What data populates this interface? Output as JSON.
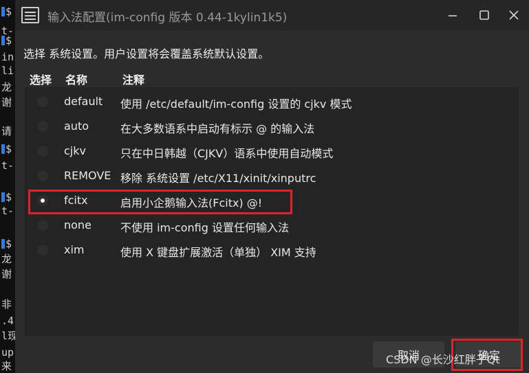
{
  "window": {
    "title": "输入法配置(im-config 版本 0.44-1kylin1k5)",
    "icons": {
      "app": "list-window-icon",
      "minimize": "minimize-icon",
      "maximize": "maximize-icon",
      "close": "close-icon"
    }
  },
  "terminal": {
    "lines": [
      "$",
      "t-",
      "$",
      "in",
      "li",
      "龙",
      "谢",
      "请",
      "$",
      "t-",
      "$",
      "t-",
      "$",
      "龙",
      "谢",
      "非",
      ".4",
      "l现",
      "up",
      "来"
    ]
  },
  "dialog": {
    "hint": "选择 系统设置。用户设置将会覆盖系统默认设置。",
    "columns": {
      "select": "选择",
      "name": "名称",
      "note": "注释"
    },
    "rows": [
      {
        "name": "default",
        "note": "使用 /etc/default/im-config 设置的 cjkv 模式",
        "selected": false
      },
      {
        "name": "auto",
        "note": "在大多数语系中启动有标示 @ 的输入法",
        "selected": false
      },
      {
        "name": "cjkv",
        "note": "只在中日韩越（CJKV）语系中使用自动模式",
        "selected": false
      },
      {
        "name": "REMOVE",
        "note": "移除 系统设置 /etc/X11/xinit/xinputrc",
        "selected": false
      },
      {
        "name": "fcitx",
        "note": "启用小企鹅输入法(Fcitx) @!",
        "selected": true
      },
      {
        "name": "none",
        "note": "不使用 im-config 设置任何输入法",
        "selected": false
      },
      {
        "name": "xim",
        "note": "使用 X 键盘扩展激活（单独） XIM 支持",
        "selected": false
      }
    ],
    "buttons": {
      "cancel": "取消",
      "ok": "确定"
    }
  },
  "watermark": "CSDN @长沙红胖子Qt",
  "colors": {
    "highlight": "#e0232b",
    "dialog_bg": "#2c2c2c",
    "list_bg": "#242424",
    "terminal_cursor": "#3b7ad9"
  }
}
